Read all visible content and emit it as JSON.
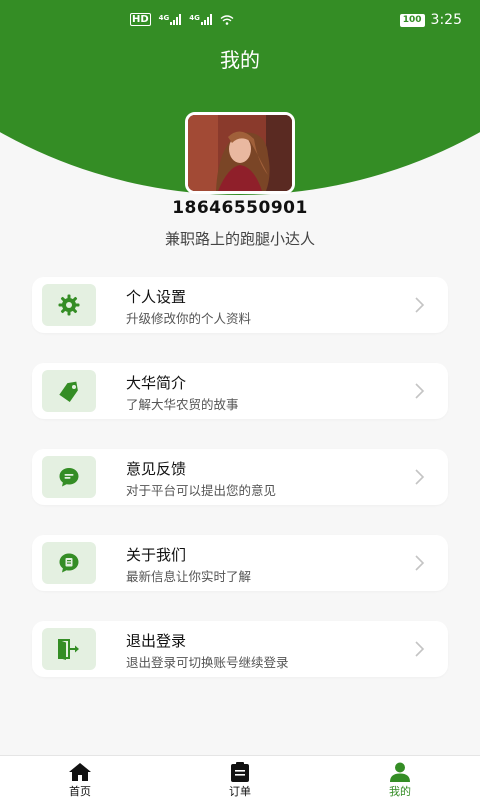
{
  "status_bar": {
    "hd": "HD",
    "net1": "4G",
    "net2": "4G",
    "battery": "100",
    "time": "3:25"
  },
  "header": {
    "title": "我的"
  },
  "profile": {
    "phone": "18646550901",
    "bio": "兼职路上的跑腿小达人"
  },
  "menu": [
    {
      "title": "个人设置",
      "subtitle": "升级修改你的个人资料",
      "icon": "gear-icon"
    },
    {
      "title": "大华简介",
      "subtitle": "了解大华农贸的故事",
      "icon": "tag-icon"
    },
    {
      "title": "意见反馈",
      "subtitle": "对于平台可以提出您的意见",
      "icon": "chat-icon"
    },
    {
      "title": "关于我们",
      "subtitle": "最新信息让你实时了解",
      "icon": "info-bubble-icon"
    },
    {
      "title": "退出登录",
      "subtitle": "退出登录可切换账号继续登录",
      "icon": "logout-icon"
    }
  ],
  "tabbar": [
    {
      "label": "首页",
      "icon": "home-icon",
      "active": false
    },
    {
      "label": "订单",
      "icon": "clipboard-icon",
      "active": false
    },
    {
      "label": "我的",
      "icon": "user-icon",
      "active": true
    }
  ],
  "colors": {
    "primary": "#348d25",
    "icon_bg": "#e4f0e1",
    "page_bg": "#f7f7f7"
  }
}
